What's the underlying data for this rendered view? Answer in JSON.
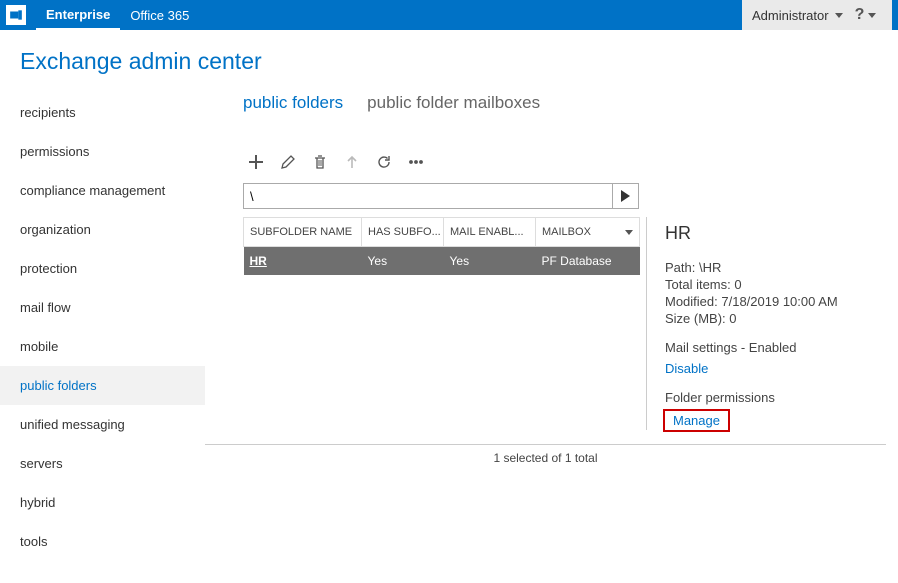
{
  "topbar": {
    "tab_enterprise": "Enterprise",
    "tab_office365": "Office 365",
    "admin_label": "Administrator",
    "help_label": "?"
  },
  "page_title": "Exchange admin center",
  "sidebar": {
    "items": [
      "recipients",
      "permissions",
      "compliance management",
      "organization",
      "protection",
      "mail flow",
      "mobile",
      "public folders",
      "unified messaging",
      "servers",
      "hybrid",
      "tools"
    ],
    "active_index": 7
  },
  "subnav": {
    "items": [
      "public folders",
      "public folder mailboxes"
    ],
    "active_index": 0
  },
  "path_value": "\\",
  "table": {
    "headers": [
      "SUBFOLDER NAME",
      "HAS SUBFO...",
      "MAIL ENABL...",
      "MAILBOX"
    ],
    "row": {
      "name": "HR",
      "has_subfolders": "Yes",
      "mail_enabled": "Yes",
      "mailbox": "PF Database"
    }
  },
  "details": {
    "title": "HR",
    "path_label": "Path:",
    "path_value": "\\HR",
    "total_items_label": "Total items:",
    "total_items_value": "0",
    "modified_label": "Modified:",
    "modified_value": "7/18/2019 10:00 AM",
    "size_label": "Size (MB):",
    "size_value": "0",
    "mail_settings_label": "Mail settings - Enabled",
    "disable_link": "Disable",
    "permissions_label": "Folder permissions",
    "manage_link": "Manage"
  },
  "status_text": "1 selected of 1 total"
}
